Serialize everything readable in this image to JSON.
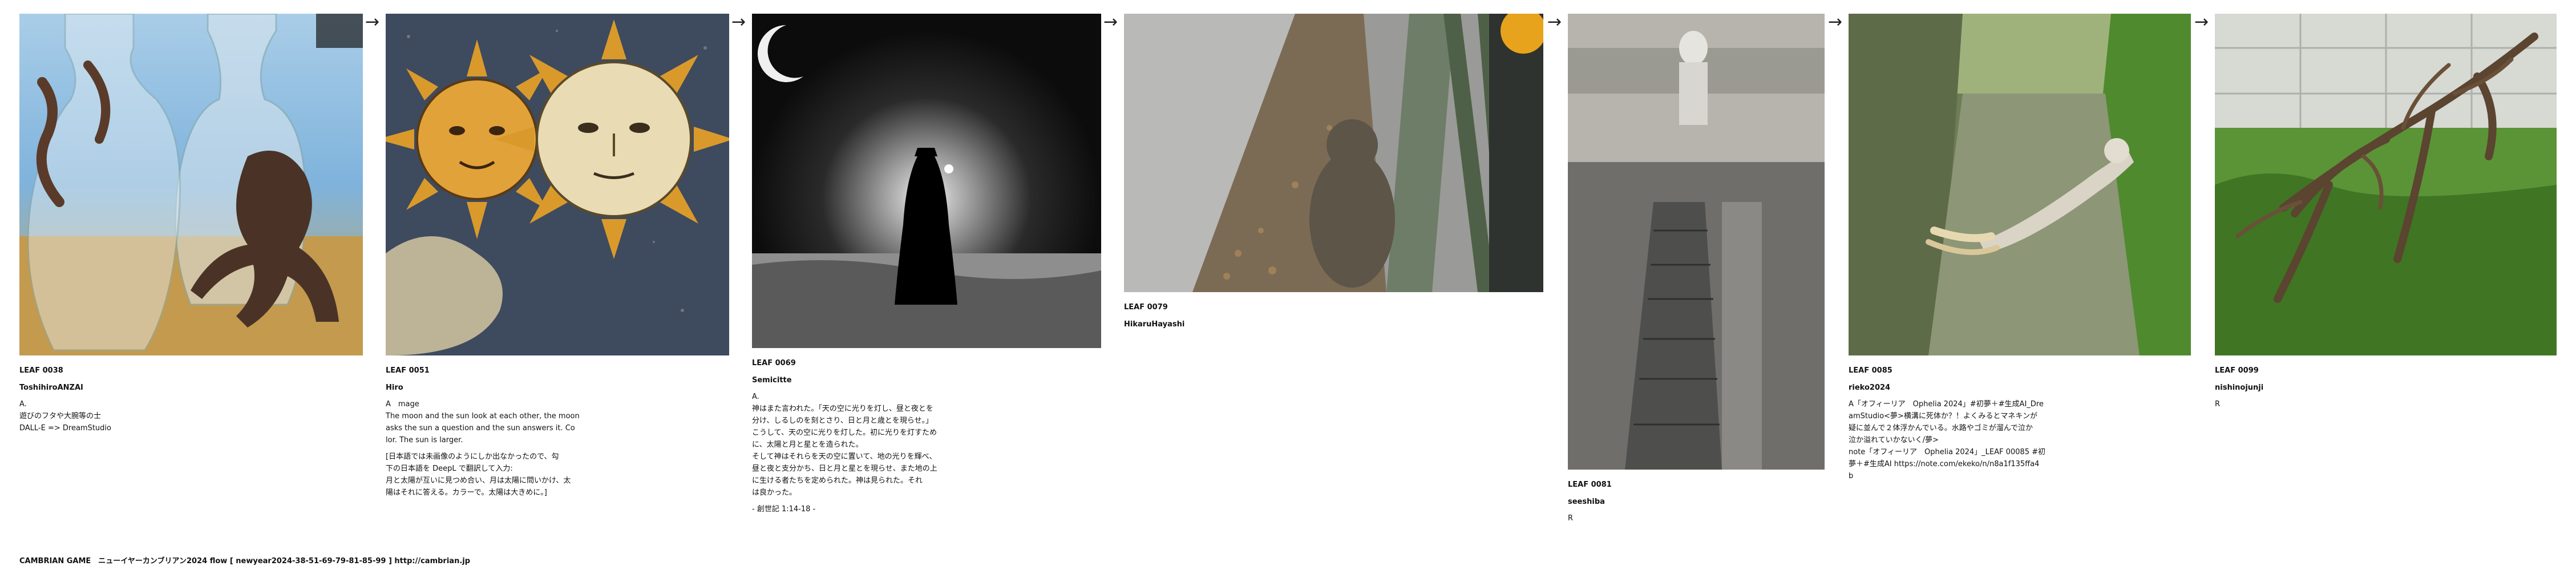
{
  "arrow_glyph": "→",
  "cards": [
    {
      "id": "LEAF 0038",
      "author": "ToshihiroANZAI",
      "body": "A.\n遊びのフタや大腕等の士\nDALL-E => DreamStudio",
      "note": ""
    },
    {
      "id": "LEAF 0051",
      "author": "Hiro",
      "body": "A　mage\nThe moon and the sun look at each other, the moon\nasks the sun a question and the sun answers it. Co\nlor. The sun is larger.",
      "note": "[日本語では未画像のようにしか出なかったので、勾\n下の日本語を DeepL で翻訳して入力:\n月と太陽が互いに見つめ合い、月は太陽に問いかけ、太\n陽はそれに答える。カラーで。太陽は大きめに。]"
    },
    {
      "id": "LEAF 0069",
      "author": "Semicitte",
      "body": "A.\n神はまた言われた。「天の空に光りを灯し、昼と夜とを\n分け、しるしのを刻とさり、日と月と歳とを現らせ。」\nこうして、天の空に光りを灯した。初に光りを灯すため\nに、太陽と月と星とを造られた。\nそして神はそれらを天の空に置いて、地の光りを輝べ、\n昼と夜と支分かち、日と月と星とを現らせ、また地の上\nに生ける者たちを定められた。神は見られた。それ\nは良かった。",
      "note": "- 創世記 1:14-18 -"
    },
    {
      "id": "LEAF 0079",
      "author": "HikaruHayashi",
      "body": "",
      "note": ""
    },
    {
      "id": "LEAF 0081",
      "author": "seeshiba",
      "body": "R",
      "note": ""
    },
    {
      "id": "LEAF 0085",
      "author": "rieko2024",
      "body": "A「オフィーリア　Ophelia 2024」#初夢＋#生成AI_Dre\namStudio<夢>横溝に死体か？！よくみるとマネキンが\n疑に並んで２体浮かんでいる。水路やゴミが溜んで泣か\n泣か溢れていかないく/夢>\nnote「オフィーリア　Ophelia 2024」_LEAF 00085 #初\n夢＋#生成AI https://note.com/ekeko/n/n8a1f135ffa4\nb",
      "note": ""
    },
    {
      "id": "LEAF 0099",
      "author": "nishinojunji",
      "body": "R",
      "note": ""
    }
  ],
  "footer": "CAMBRIAN GAME　ニューイヤーカンブリアン2024  flow [ newyear2024-38-51-69-79-81-85-99 ]    http://cambrian.jp",
  "colors": {
    "sky": "#7fb3dc",
    "sun_gold": "#d99a2b",
    "night": "#0c0c0c",
    "forest_green": "#4f8a2e",
    "water_green": "#6d7d56"
  }
}
